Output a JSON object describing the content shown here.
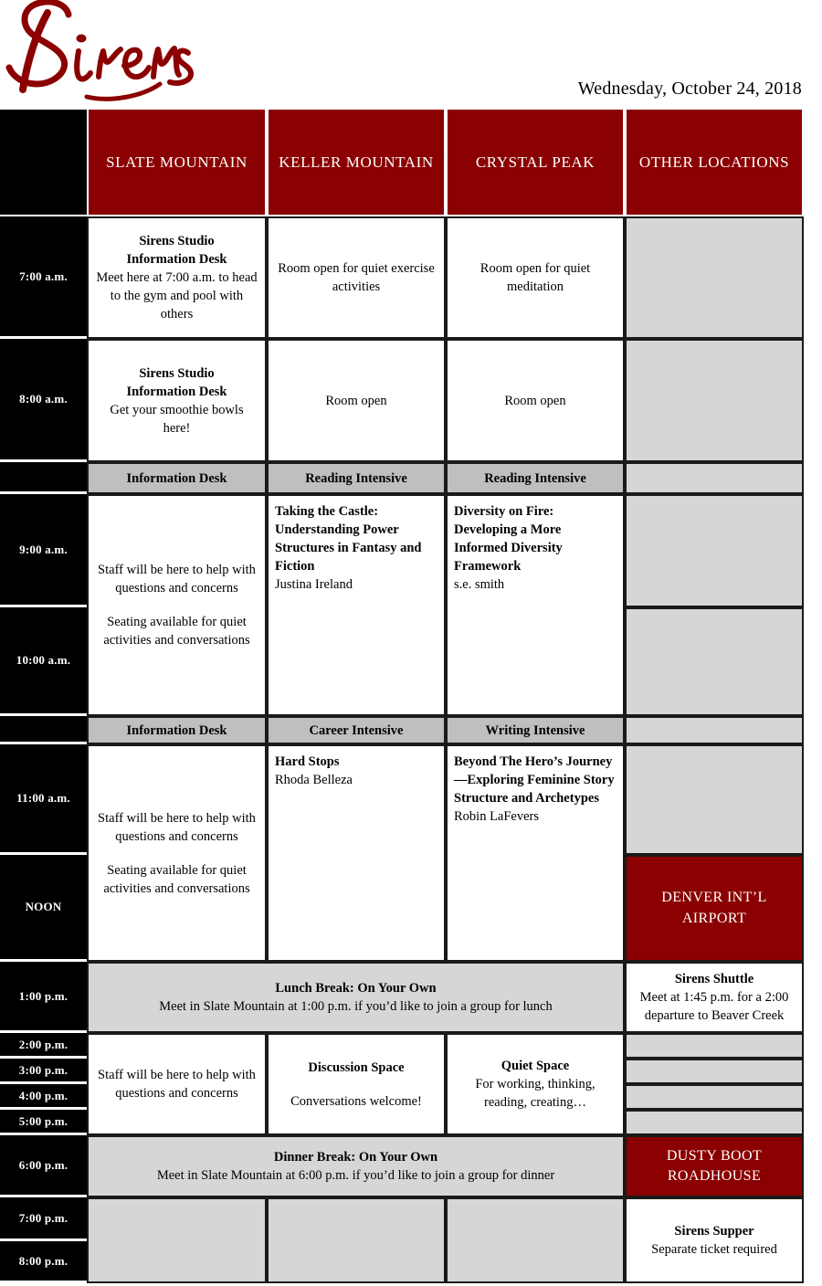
{
  "masthead": {
    "logo_text": "Sirens",
    "date": "Wednesday, October 24, 2018"
  },
  "columns": {
    "time_header": "",
    "slate": "SLATE MOUNTAIN",
    "keller": "KELLER MOUNTAIN",
    "crystal": "CRYSTAL PEAK",
    "other": "OTHER LOCATIONS"
  },
  "times": {
    "t0700": "7:00 a.m.",
    "t0800": "8:00 a.m.",
    "t0900": "9:00 a.m.",
    "t1000": "10:00 a.m.",
    "t1100": "11:00 a.m.",
    "noon": "NOON",
    "t0100": "1:00 p.m.",
    "t0200": "2:00 p.m.",
    "t0300": "3:00 p.m.",
    "t0400": "4:00 p.m.",
    "t0500": "5:00 p.m.",
    "t0600": "6:00 p.m.",
    "t0700p": "7:00 p.m.",
    "t0800p": "8:00 p.m."
  },
  "rows": {
    "seven": {
      "slate_title1": "Sirens Studio",
      "slate_title2": "Information Desk",
      "slate_body": "Meet here at 7:00 a.m. to head to the gym and pool with others",
      "keller": "Room open for quiet exercise activities",
      "crystal": "Room open for quiet meditation"
    },
    "eight": {
      "slate_title1": "Sirens Studio",
      "slate_title2": "Information Desk",
      "slate_body": "Get your smoothie bowls here!",
      "keller": "Room open",
      "crystal": "Room open"
    },
    "morning_subheaders": {
      "slate": "Information Desk",
      "keller": "Reading Intensive",
      "crystal": "Reading Intensive"
    },
    "nine_ten": {
      "slate_line1": "Staff will be here to help with questions and concerns",
      "slate_line2": "Seating available for quiet activities and conversations",
      "keller_title": "Taking the Castle: Understanding Power Structures in Fantasy and Fiction",
      "keller_presenter": "Justina Ireland",
      "crystal_title": "Diversity on Fire: Developing a More Informed Diversity Framework",
      "crystal_presenter": "s.e. smith"
    },
    "midday_subheaders": {
      "slate": "Information Desk",
      "keller": "Career Intensive",
      "crystal": "Writing Intensive"
    },
    "eleven_noon": {
      "slate_line1": "Staff will be here to help with questions and concerns",
      "slate_line2": "Seating available for quiet activities and conversations",
      "keller_title": "Hard Stops",
      "keller_presenter": "Rhoda Belleza",
      "crystal_title": "Beyond The Hero’s Journey—Exploring Feminine Story Structure and Archetypes",
      "crystal_presenter": "Robin LaFevers",
      "other_airport": "DENVER INT’L AIRPORT"
    },
    "lunch": {
      "title": "Lunch Break: On Your Own",
      "body": "Meet in Slate Mountain at 1:00 p.m. if you’d like to join a group for lunch",
      "shuttle_title": "Sirens Shuttle",
      "shuttle_body": "Meet at 1:45 p.m. for a 2:00 departure to Beaver Creek"
    },
    "afternoon": {
      "slate": "Staff will be here to help with questions and concerns",
      "keller_title": "Discussion Space",
      "keller_body": "Conversations welcome!",
      "crystal_title": "Quiet Space",
      "crystal_body": "For working, thinking, reading, creating…"
    },
    "dinner": {
      "title": "Dinner Break: On Your Own",
      "body": "Meet in Slate Mountain at 6:00 p.m. if you’d like to join a group for dinner",
      "other": "DUSTY BOOT ROADHOUSE"
    },
    "evening": {
      "supper_title": "Sirens Supper",
      "supper_body": "Separate ticket required"
    }
  },
  "colors": {
    "brand_red": "#8b0000",
    "header_black": "#000000",
    "light_gray": "#d6d6d6",
    "sub_gray": "#bfbfbf"
  }
}
